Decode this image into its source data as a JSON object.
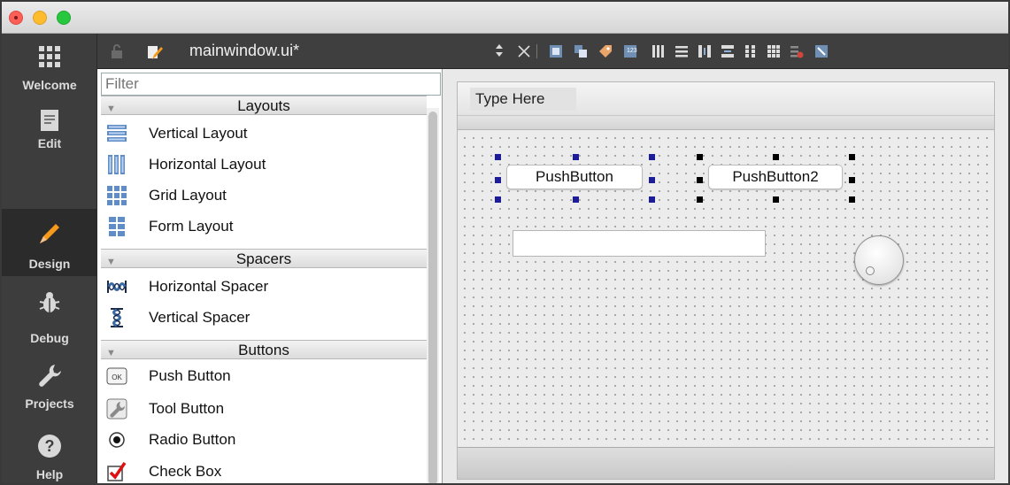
{
  "window": {
    "file_title": "mainwindow.ui*"
  },
  "modes": [
    {
      "label": "Welcome",
      "icon": "grid-icon"
    },
    {
      "label": "Edit",
      "icon": "document-icon"
    },
    {
      "label": "Design",
      "icon": "pencil-icon",
      "active": true
    },
    {
      "label": "Debug",
      "icon": "bug-icon"
    },
    {
      "label": "Projects",
      "icon": "wrench-icon"
    },
    {
      "label": "Help",
      "icon": "question-icon"
    }
  ],
  "widget_box": {
    "filter_placeholder": "Filter",
    "categories": [
      {
        "title": "Layouts",
        "items": [
          "Vertical Layout",
          "Horizontal Layout",
          "Grid Layout",
          "Form Layout"
        ]
      },
      {
        "title": "Spacers",
        "items": [
          "Horizontal Spacer",
          "Vertical Spacer"
        ]
      },
      {
        "title": "Buttons",
        "items": [
          "Push Button",
          "Tool Button",
          "Radio Button",
          "Check Box"
        ]
      }
    ]
  },
  "form": {
    "menu_placeholder": "Type Here",
    "buttons": [
      "PushButton",
      "PushButton2"
    ]
  },
  "colors": {
    "accent_selection": "#1d1d9a",
    "modebar": "#3d3d3d"
  }
}
